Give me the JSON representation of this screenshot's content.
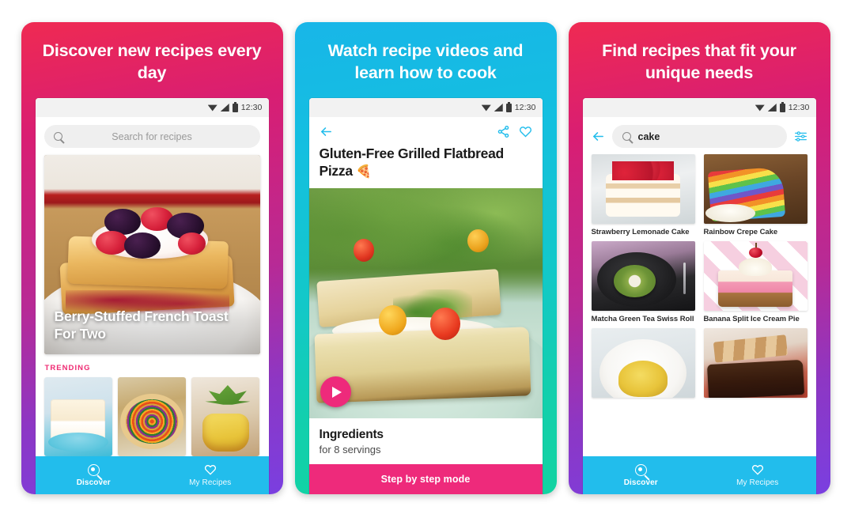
{
  "panels": [
    {
      "headline": "Discover new recipes every day",
      "status": {
        "time": "12:30"
      },
      "search": {
        "placeholder": "Search for recipes"
      },
      "hero": {
        "title": "Berry-Stuffed French Toast For Two"
      },
      "trending_label": "TRENDING",
      "nav": [
        {
          "label": "Discover",
          "icon": "search-magnifier-icon",
          "active": true
        },
        {
          "label": "My Recipes",
          "icon": "heart-icon",
          "active": false
        }
      ]
    },
    {
      "headline": "Watch recipe videos and learn how to cook",
      "status": {
        "time": "12:30"
      },
      "icons": {
        "back": "back-arrow-icon",
        "share": "share-icon",
        "favorite": "heart-outline-icon"
      },
      "recipe_title": "Gluten-Free Grilled Flatbread Pizza",
      "recipe_title_emoji": "🍕",
      "play_button": "play-icon",
      "ingredients_heading": "Ingredients",
      "ingredients_sub": "for 8 servings",
      "step_button": "Step by step mode"
    },
    {
      "headline": "Find recipes that fit your unique needs",
      "status": {
        "time": "12:30"
      },
      "search": {
        "value": "cake",
        "icon": "search-magnifier-icon"
      },
      "filter_icon": "filter-sliders-icon",
      "results": [
        {
          "title": "Strawberry Lemonade Cake"
        },
        {
          "title": "Rainbow Crepe Cake"
        },
        {
          "title": "Matcha Green Tea Swiss Roll"
        },
        {
          "title": "Banana Split Ice Cream Pie"
        },
        {
          "title": ""
        },
        {
          "title": ""
        }
      ],
      "nav": [
        {
          "label": "Discover",
          "icon": "search-magnifier-icon",
          "active": true
        },
        {
          "label": "My Recipes",
          "icon": "heart-icon",
          "active": false
        }
      ]
    }
  ],
  "colors": {
    "pink_gradient_start": "#ef2a52",
    "pink_gradient_end": "#7a3fe0",
    "cyan_gradient_start": "#18b6e8",
    "cyan_gradient_end": "#13d3a1",
    "nav_bar": "#22bdec",
    "accent_magenta": "#ee2a7b",
    "trending_label": "#ef2a72"
  }
}
